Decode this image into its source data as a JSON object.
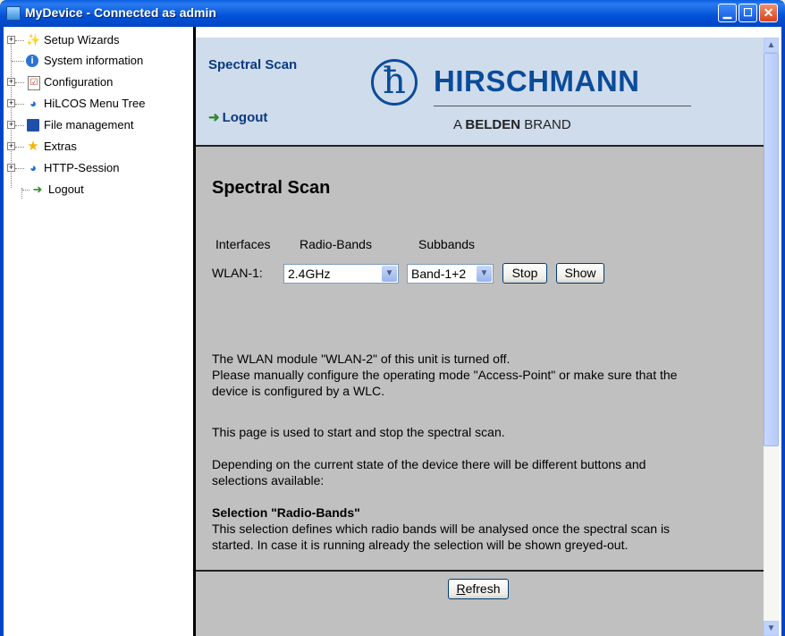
{
  "window": {
    "title": "MyDevice - Connected as admin",
    "min_icon": "minimize-icon",
    "max_icon": "maximize-icon",
    "close_icon": "close-icon"
  },
  "tree": {
    "items": [
      {
        "label": "Setup Wizards",
        "icon": "wand-icon",
        "expandable": true
      },
      {
        "label": "System information",
        "icon": "info-icon",
        "expandable": false
      },
      {
        "label": "Configuration",
        "icon": "config-icon",
        "expandable": true
      },
      {
        "label": "HiLCOS Menu Tree",
        "icon": "globe-icon",
        "expandable": true
      },
      {
        "label": "File management",
        "icon": "floppy-icon",
        "expandable": true
      },
      {
        "label": "Extras",
        "icon": "star-icon",
        "expandable": true
      },
      {
        "label": "HTTP-Session",
        "icon": "globe-icon",
        "expandable": true
      },
      {
        "label": "Logout",
        "icon": "logout-icon",
        "expandable": false
      }
    ]
  },
  "header": {
    "title": "Spectral Scan",
    "logout": "Logout",
    "logo": {
      "brand": "HIRSCHMANN",
      "tag_prefix": "A ",
      "tag_bold": "BELDEN",
      "tag_suffix": " BRAND",
      "letter": "ħ"
    }
  },
  "main": {
    "heading": "Spectral Scan",
    "columns": {
      "interfaces": "Interfaces",
      "radio_bands": "Radio-Bands",
      "subbands": "Subbands"
    },
    "wlan_label": "WLAN-1:",
    "radio_band_value": "2.4GHz",
    "subband_value": "Band-1+2",
    "stop_label": "Stop",
    "show_label": "Show",
    "notice_line1": "The WLAN module \"WLAN-2\" of this unit is turned off.",
    "notice_line2": "Please manually configure the operating mode \"Access-Point\" or make sure that the",
    "notice_line3": "device is configured by a WLC.",
    "info_1": "This page is used to start and stop the spectral scan.",
    "info_2a": "Depending on the current state of the device there will be different buttons and",
    "info_2b": "selections available:",
    "sel_title": "Selection \"Radio-Bands\"",
    "sel_text_1": "This selection defines which radio bands will be analysed once the spectral scan is",
    "sel_text_2": "started. In case it is running already the selection will be shown greyed-out."
  },
  "footer": {
    "refresh_accel": "R",
    "refresh_rest": "efresh"
  },
  "colors": {
    "title_bar": "#0052d6",
    "header_bg": "#cfdcec",
    "content_bg": "#c0c0c0",
    "brand_blue": "#0b4c9a"
  }
}
